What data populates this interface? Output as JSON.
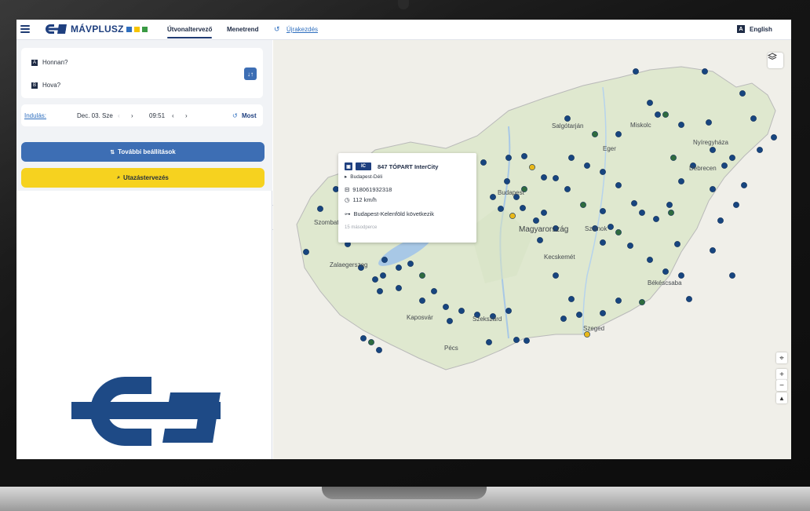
{
  "nav": {
    "logo_text": "MÁVPLUSZ",
    "logo_colors": [
      "#2f6fbf",
      "#f6c400",
      "#3a9a44"
    ],
    "tabs": [
      {
        "label": "Útvonaltervező",
        "active": true
      },
      {
        "label": "Menetrend",
        "active": false
      },
      {
        "label": "Újrakezdés",
        "active": false
      }
    ],
    "language_badge": "A",
    "language": "English"
  },
  "search": {
    "from_badge": "A",
    "from_placeholder": "Honnan?",
    "to_badge": "B",
    "to_placeholder": "Hova?",
    "swap_icon": "↓↑",
    "departure_label": "Indulás:",
    "date": "Dec. 03. Sze",
    "time": "09:51",
    "now_label": "Most"
  },
  "buttons": {
    "more_settings": "További beállítások",
    "plan": "Utazástervezés"
  },
  "map": {
    "places": [
      "Salgótarján",
      "Miskolc",
      "Nyíregyháza",
      "Eger",
      "Debrecen",
      "Budapest",
      "Magyarország",
      "Szolnok",
      "Kecskemét",
      "Békéscsaba",
      "Szombathely",
      "Zalaegerszeg",
      "Kaposvár",
      "Szekszárd",
      "Pécs",
      "Szeged"
    ]
  },
  "popup": {
    "operator_tag": "IC",
    "train_name": "847 TÓPART InterCity",
    "route": "Budapest-Déli",
    "vehicle_id": "918061932318",
    "speed": "112 km/h",
    "next_stop": "Budapest-Kelenföld következik",
    "footnote": "15 másodperce"
  },
  "colors": {
    "brand": "#1e3f7f",
    "primary_button": "#3d6eb4",
    "plan_button": "#f6d21f",
    "train_dot": "#17457f",
    "train_dot_delayed": "#2e6b3e",
    "train_dot_late": "#e8b81a"
  }
}
